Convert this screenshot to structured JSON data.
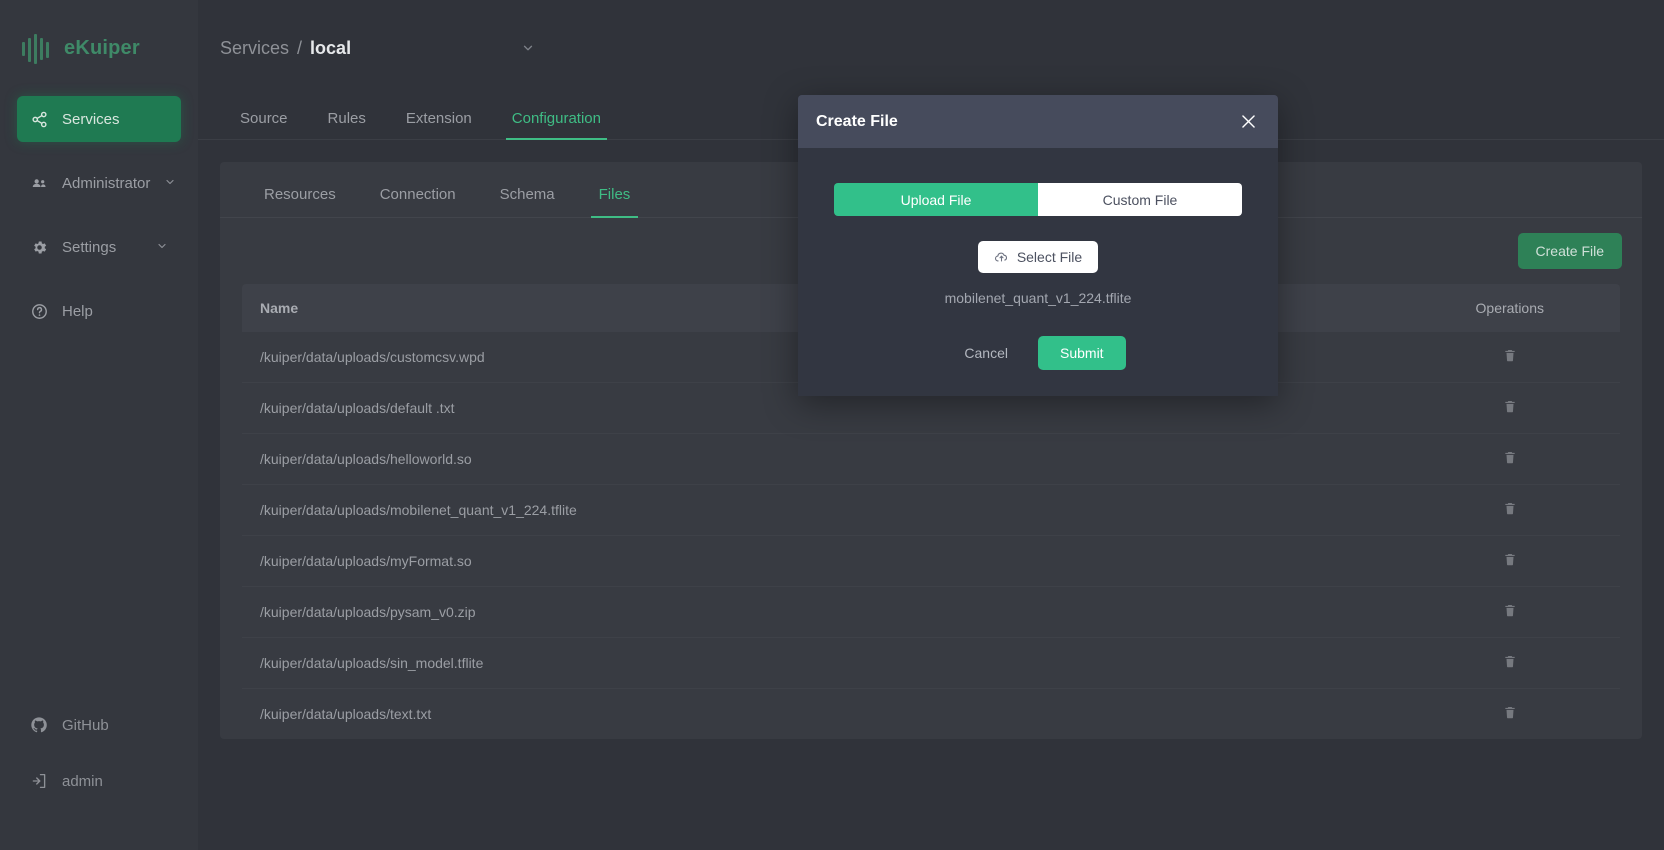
{
  "app": {
    "brand": "eKuiper",
    "accent": "#32c08a",
    "accent_dark": "#2e8157",
    "sidebar_bg": "#34373e",
    "main_bg": "#30333a",
    "panel_bg": "#383b42",
    "modal_bg": "#323641",
    "modal_header_bg": "#464b5c"
  },
  "sidebar": {
    "items": [
      {
        "label": "Services",
        "icon": "share-icon",
        "active": true,
        "chevron": false
      },
      {
        "label": "Administrator",
        "icon": "users-icon",
        "active": false,
        "chevron": true
      },
      {
        "label": "Settings",
        "icon": "gear-icon",
        "active": false,
        "chevron": true
      },
      {
        "label": "Help",
        "icon": "help-icon",
        "active": false,
        "chevron": false
      }
    ],
    "bottom": [
      {
        "label": "GitHub",
        "icon": "github-icon"
      },
      {
        "label": "admin",
        "icon": "logout-icon"
      }
    ]
  },
  "breadcrumb": {
    "root": "Services",
    "separator": "/",
    "current": "local",
    "chevron": "chevron-down-icon"
  },
  "top_tabs": [
    {
      "label": "Source",
      "active": false
    },
    {
      "label": "Rules",
      "active": false
    },
    {
      "label": "Extension",
      "active": false
    },
    {
      "label": "Configuration",
      "active": true
    }
  ],
  "sub_tabs": [
    {
      "label": "Resources",
      "active": false
    },
    {
      "label": "Connection",
      "active": false
    },
    {
      "label": "Schema",
      "active": false
    },
    {
      "label": "Files",
      "active": true
    }
  ],
  "toolbar": {
    "create_file_label": "Create File"
  },
  "table": {
    "columns": [
      {
        "key": "name",
        "label": "Name"
      },
      {
        "key": "mid",
        "label": ""
      },
      {
        "key": "ops",
        "label": "Operations"
      }
    ],
    "delete_icon": "trash-icon",
    "rows": [
      {
        "name": "/kuiper/data/uploads/customcsv.wpd"
      },
      {
        "name": "/kuiper/data/uploads/default .txt"
      },
      {
        "name": "/kuiper/data/uploads/helloworld.so"
      },
      {
        "name": "/kuiper/data/uploads/mobilenet_quant_v1_224.tflite"
      },
      {
        "name": "/kuiper/data/uploads/myFormat.so"
      },
      {
        "name": "/kuiper/data/uploads/pysam_v0.zip"
      },
      {
        "name": "/kuiper/data/uploads/sin_model.tflite"
      },
      {
        "name": "/kuiper/data/uploads/text.txt"
      }
    ]
  },
  "modal": {
    "title": "Create File",
    "close_icon": "close-icon",
    "segment": {
      "upload_label": "Upload File",
      "custom_label": "Custom File",
      "selected": "Upload File"
    },
    "select_button": {
      "label": "Select File",
      "icon": "cloud-upload-icon"
    },
    "selected_filename": "mobilenet_quant_v1_224.tflite",
    "cancel_label": "Cancel",
    "submit_label": "Submit"
  }
}
